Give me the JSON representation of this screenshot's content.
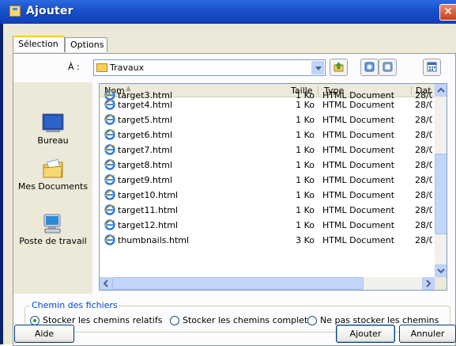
{
  "window": {
    "title": "Ajouter",
    "close_label": "✕"
  },
  "tabs": [
    {
      "label": "Sélection"
    },
    {
      "label": "Options"
    }
  ],
  "look_in": {
    "label": "À :",
    "value": "Travaux"
  },
  "places": [
    {
      "label": "Bureau"
    },
    {
      "label": "Mes Documents"
    },
    {
      "label": "Poste de travail"
    }
  ],
  "columns": {
    "name": "Nom",
    "size": "Taille",
    "type": "Type",
    "date": "Dat"
  },
  "files": [
    {
      "name": "target3.html",
      "size": "1 Ko",
      "type": "HTML Document",
      "date": "28/0"
    },
    {
      "name": "target4.html",
      "size": "1 Ko",
      "type": "HTML Document",
      "date": "28/0"
    },
    {
      "name": "target5.html",
      "size": "1 Ko",
      "type": "HTML Document",
      "date": "28/0"
    },
    {
      "name": "target6.html",
      "size": "1 Ko",
      "type": "HTML Document",
      "date": "28/0"
    },
    {
      "name": "target7.html",
      "size": "1 Ko",
      "type": "HTML Document",
      "date": "28/0"
    },
    {
      "name": "target8.html",
      "size": "1 Ko",
      "type": "HTML Document",
      "date": "28/0"
    },
    {
      "name": "target9.html",
      "size": "1 Ko",
      "type": "HTML Document",
      "date": "28/0"
    },
    {
      "name": "target10.html",
      "size": "1 Ko",
      "type": "HTML Document",
      "date": "28/0"
    },
    {
      "name": "target11.html",
      "size": "1 Ko",
      "type": "HTML Document",
      "date": "28/0"
    },
    {
      "name": "target12.html",
      "size": "1 Ko",
      "type": "HTML Document",
      "date": "28/0"
    },
    {
      "name": "thumbnails.html",
      "size": "3 Ko",
      "type": "HTML Document",
      "date": "28/0"
    }
  ],
  "path_group": {
    "legend": "Chemin des fichiers",
    "options": [
      {
        "label": "Stocker les chemins relatifs",
        "selected": true
      },
      {
        "label": "Stocker les chemins complets",
        "selected": false
      },
      {
        "label": "Ne pas stocker les chemins",
        "selected": false
      }
    ]
  },
  "buttons": {
    "help": "Aide",
    "add": "Ajouter",
    "cancel": "Annuler"
  },
  "icons": {
    "title": "window-icon",
    "folder": "folder-icon",
    "up": "up-folder-icon",
    "new_folder": "new-folder-icon",
    "view": "view-menu-icon",
    "file": "ie-html-icon"
  },
  "colors": {
    "titlebar": "#0f3fb6",
    "accent": "#0046d5",
    "radio_on": "#21a121"
  }
}
